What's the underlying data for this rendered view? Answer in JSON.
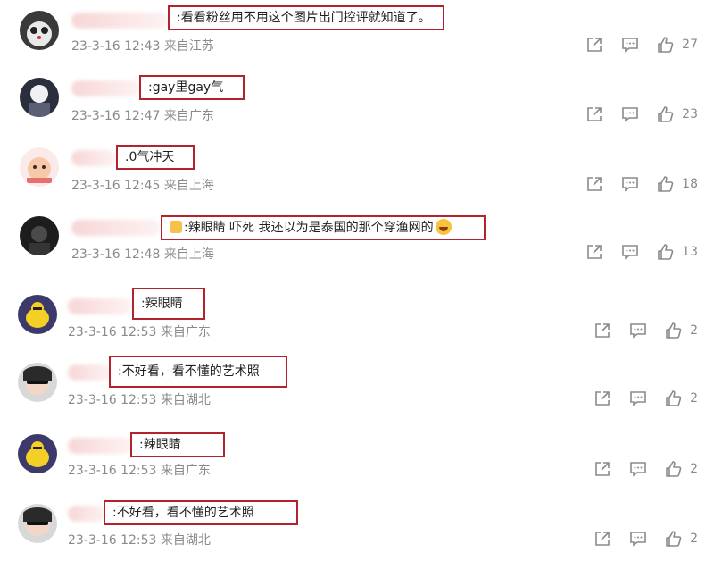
{
  "comments": [
    {
      "text": ":看看粉丝用不用这个图片出门控评就知道了。",
      "date": "23-3-16 12:43",
      "location": "来自江苏",
      "likes": "27"
    },
    {
      "text": ":gay里gay气",
      "date": "23-3-16 12:47",
      "location": "来自广东",
      "likes": "23"
    },
    {
      "text": ".0气冲天",
      "date": "23-3-16 12:45",
      "location": "来自上海",
      "likes": "18"
    },
    {
      "text": ":辣眼睛 吓死 我还以为是泰国的那个穿渔网的",
      "date": "23-3-16 12:48",
      "location": "来自上海",
      "likes": "13"
    },
    {
      "text": ":辣眼睛",
      "date": "23-3-16 12:53",
      "location": "来自广东",
      "likes": "2"
    },
    {
      "text": ":不好看，看不懂的艺术照",
      "date": "23-3-16 12:53",
      "location": "来自湖北",
      "likes": "2"
    },
    {
      "text": ":辣眼睛",
      "date": "23-3-16 12:53",
      "location": "来自广东",
      "likes": "2"
    },
    {
      "text": ":不好看，看不懂的艺术照",
      "date": "23-3-16 12:53",
      "location": "来自湖北",
      "likes": "2"
    }
  ],
  "icons": {
    "share": "share-icon",
    "comment": "comment-icon",
    "like": "thumbs-up-icon"
  },
  "colors": {
    "highlight_border": "#b3232d",
    "meta_text": "#8a8a8a"
  }
}
